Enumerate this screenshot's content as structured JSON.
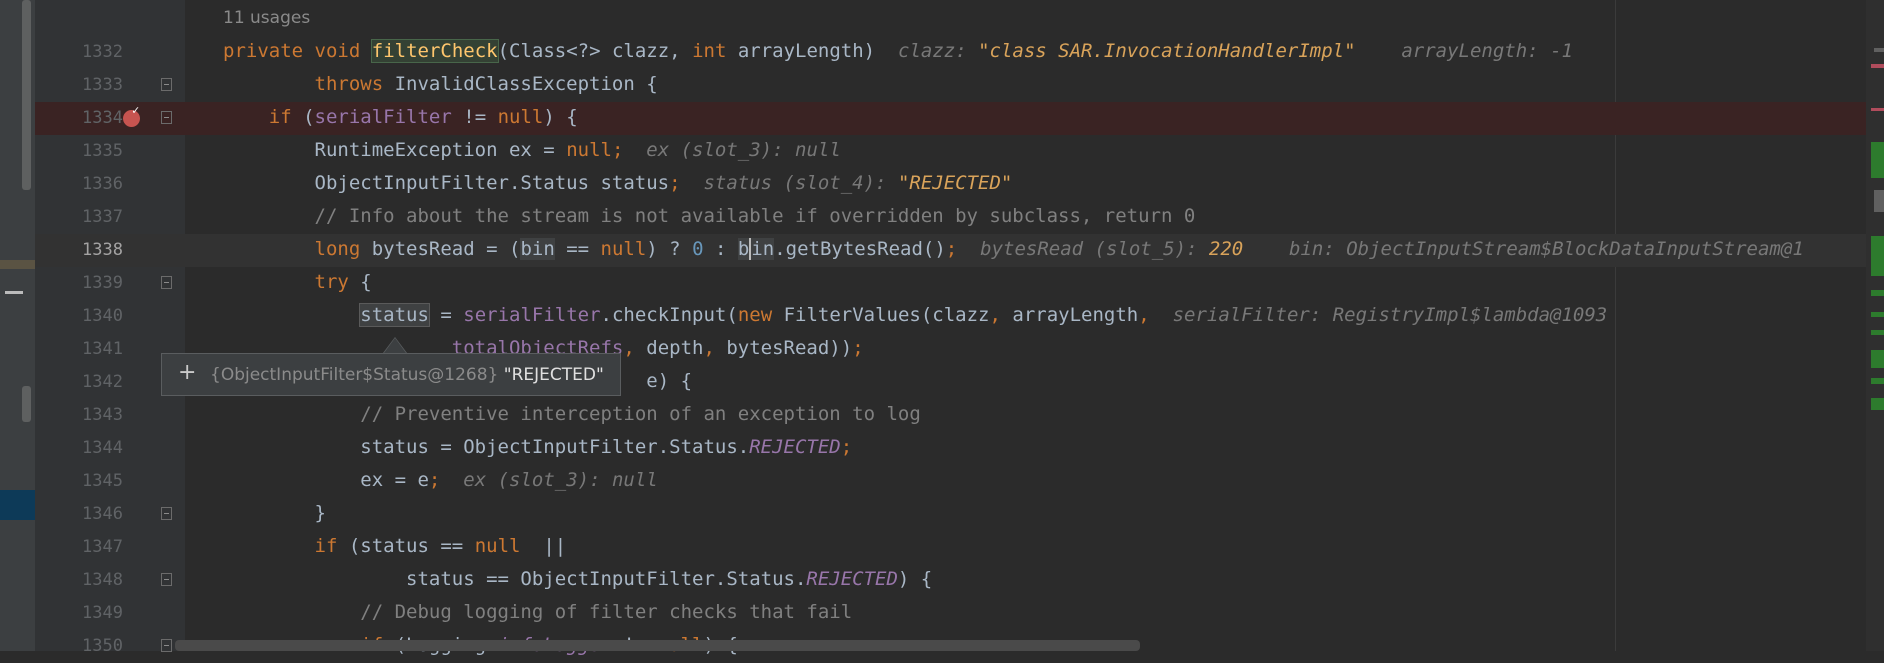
{
  "editor": {
    "usages_hint": "11 usages",
    "colors": {
      "background": "#2b2b2b",
      "keyword": "#cc7832",
      "field": "#9876aa",
      "comment": "#808080",
      "breakpoint": "#c75450",
      "number": "#6897bb"
    },
    "lines": [
      {
        "no": "1332",
        "t": {
          "kw1": "private",
          "kw2": "void",
          "name": "filterCheck",
          "p1": "(Class<?> clazz, ",
          "kw3": "int",
          "p2": " arrayLength)",
          "h1k": "clazz: ",
          "h1v": "\"class SAR.InvocationHandlerImpl\"",
          "h2k": "arrayLength: ",
          "h2v": "-1"
        }
      },
      {
        "no": "1333",
        "t": {
          "kw1": "throws",
          "p1": " InvalidClassException {"
        }
      },
      {
        "no": "1334",
        "t": {
          "kw1": "if",
          "p1": " (",
          "f1": "serialFilter",
          "p2": " != ",
          "kw2": "null",
          "p3": ") {"
        }
      },
      {
        "no": "1335",
        "t": {
          "p1": "RuntimeException ex = ",
          "kw1": "null",
          "s1": ";",
          "h1": "ex (slot_3): null"
        }
      },
      {
        "no": "1336",
        "t": {
          "p1": "ObjectInputFilter.Status status",
          "s1": ";",
          "h1k": "status (slot_4): ",
          "h1v": "\"REJECTED\""
        }
      },
      {
        "no": "1337",
        "t": {
          "c1": "// Info about the stream is not available if overridden by subclass, return 0"
        }
      },
      {
        "no": "1338",
        "t": {
          "kw1": "long",
          "p1": " bytesRead = (",
          "r1": "bin",
          "p2": " == ",
          "kw2": "null",
          "p3": ") ? ",
          "n1": "0",
          "p4": " : ",
          "r2a": "b",
          "r2b": "in",
          "p5": ".getBytesRead()",
          "s1": ";",
          "h1k": "bytesRead (slot_5): ",
          "h1v": "220",
          "h2": "bin: ObjectInputStream$BlockDataInputStream@1"
        }
      },
      {
        "no": "1339",
        "t": {
          "kw1": "try",
          "p1": " {"
        }
      },
      {
        "no": "1340",
        "t": {
          "r1": "status",
          "p1": " = ",
          "f1": "serialFilter",
          "p2": ".checkInput(",
          "kw1": "new",
          "p3": " FilterValues(clazz",
          "s1": ",",
          "p4": " arrayLength",
          "s2": ",",
          "h1": "serialFilter: RegistryImpl$lambda@1093"
        }
      },
      {
        "no": "1341",
        "t": {
          "f1": "totalObjectRefs",
          "s1": ",",
          "p1": " depth",
          "s2": ",",
          "p2": " bytesRead))",
          "s3": ";"
        }
      },
      {
        "no": "1342",
        "t": {
          "p1": " e) {"
        }
      },
      {
        "no": "1343",
        "t": {
          "c1": "// Preventive interception of an exception to log"
        }
      },
      {
        "no": "1344",
        "t": {
          "p1": "status = ObjectInputFilter.Status.",
          "fi1": "REJECTED",
          "s1": ";"
        }
      },
      {
        "no": "1345",
        "t": {
          "p1": "ex = e",
          "s1": ";",
          "h1": "ex (slot_3): null"
        }
      },
      {
        "no": "1346",
        "t": {
          "p1": "}"
        }
      },
      {
        "no": "1347",
        "t": {
          "kw1": "if",
          "p1": " (status == ",
          "kw2": "null",
          "p2": "  ||"
        }
      },
      {
        "no": "1348",
        "t": {
          "p1": "status == ObjectInputFilter.Status.",
          "fi1": "REJECTED",
          "p2": ") {"
        }
      },
      {
        "no": "1349",
        "t": {
          "c1": "// Debug logging of filter checks that fail"
        }
      },
      {
        "no": "1350",
        "t": {
          "kw1": "if",
          "p1": " (Logging.",
          "fi1": "infoLogger",
          "p2": " != ",
          "kw2": "null",
          "p3": ") {"
        }
      }
    ]
  },
  "popup": {
    "expand": "+",
    "object": "{ObjectInputFilter$Status@1268}",
    "value": "\"REJECTED\""
  }
}
